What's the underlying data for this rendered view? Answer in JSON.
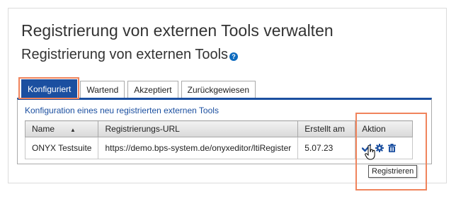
{
  "page": {
    "title": "Registrierung von externen Tools verwalten",
    "subtitle": "Registrierung von externen Tools",
    "help_icon": "question-circle-icon"
  },
  "tabs": [
    {
      "label": "Konfiguriert",
      "active": true
    },
    {
      "label": "Wartend",
      "active": false
    },
    {
      "label": "Akzeptiert",
      "active": false
    },
    {
      "label": "Zurückgewiesen",
      "active": false
    }
  ],
  "section": {
    "caption": "Konfiguration eines neu registrierten externen Tools"
  },
  "table": {
    "columns": [
      "Name",
      "Registrierungs-URL",
      "Erstellt am",
      "Aktion"
    ],
    "sort_column": "Name",
    "sort_direction": "ascending",
    "rows": [
      {
        "name": "ONYX Testsuite",
        "url": "https://demo.bps-system.de/onyxeditor/ltiRegister",
        "created": "5.07.23",
        "actions": [
          "check-icon",
          "gear-icon",
          "trash-icon"
        ]
      }
    ]
  },
  "tooltip": "Registrieren",
  "colors": {
    "accent": "#1b4fa0",
    "highlight": "#f0845c",
    "action_icon": "#1b4fa0"
  }
}
